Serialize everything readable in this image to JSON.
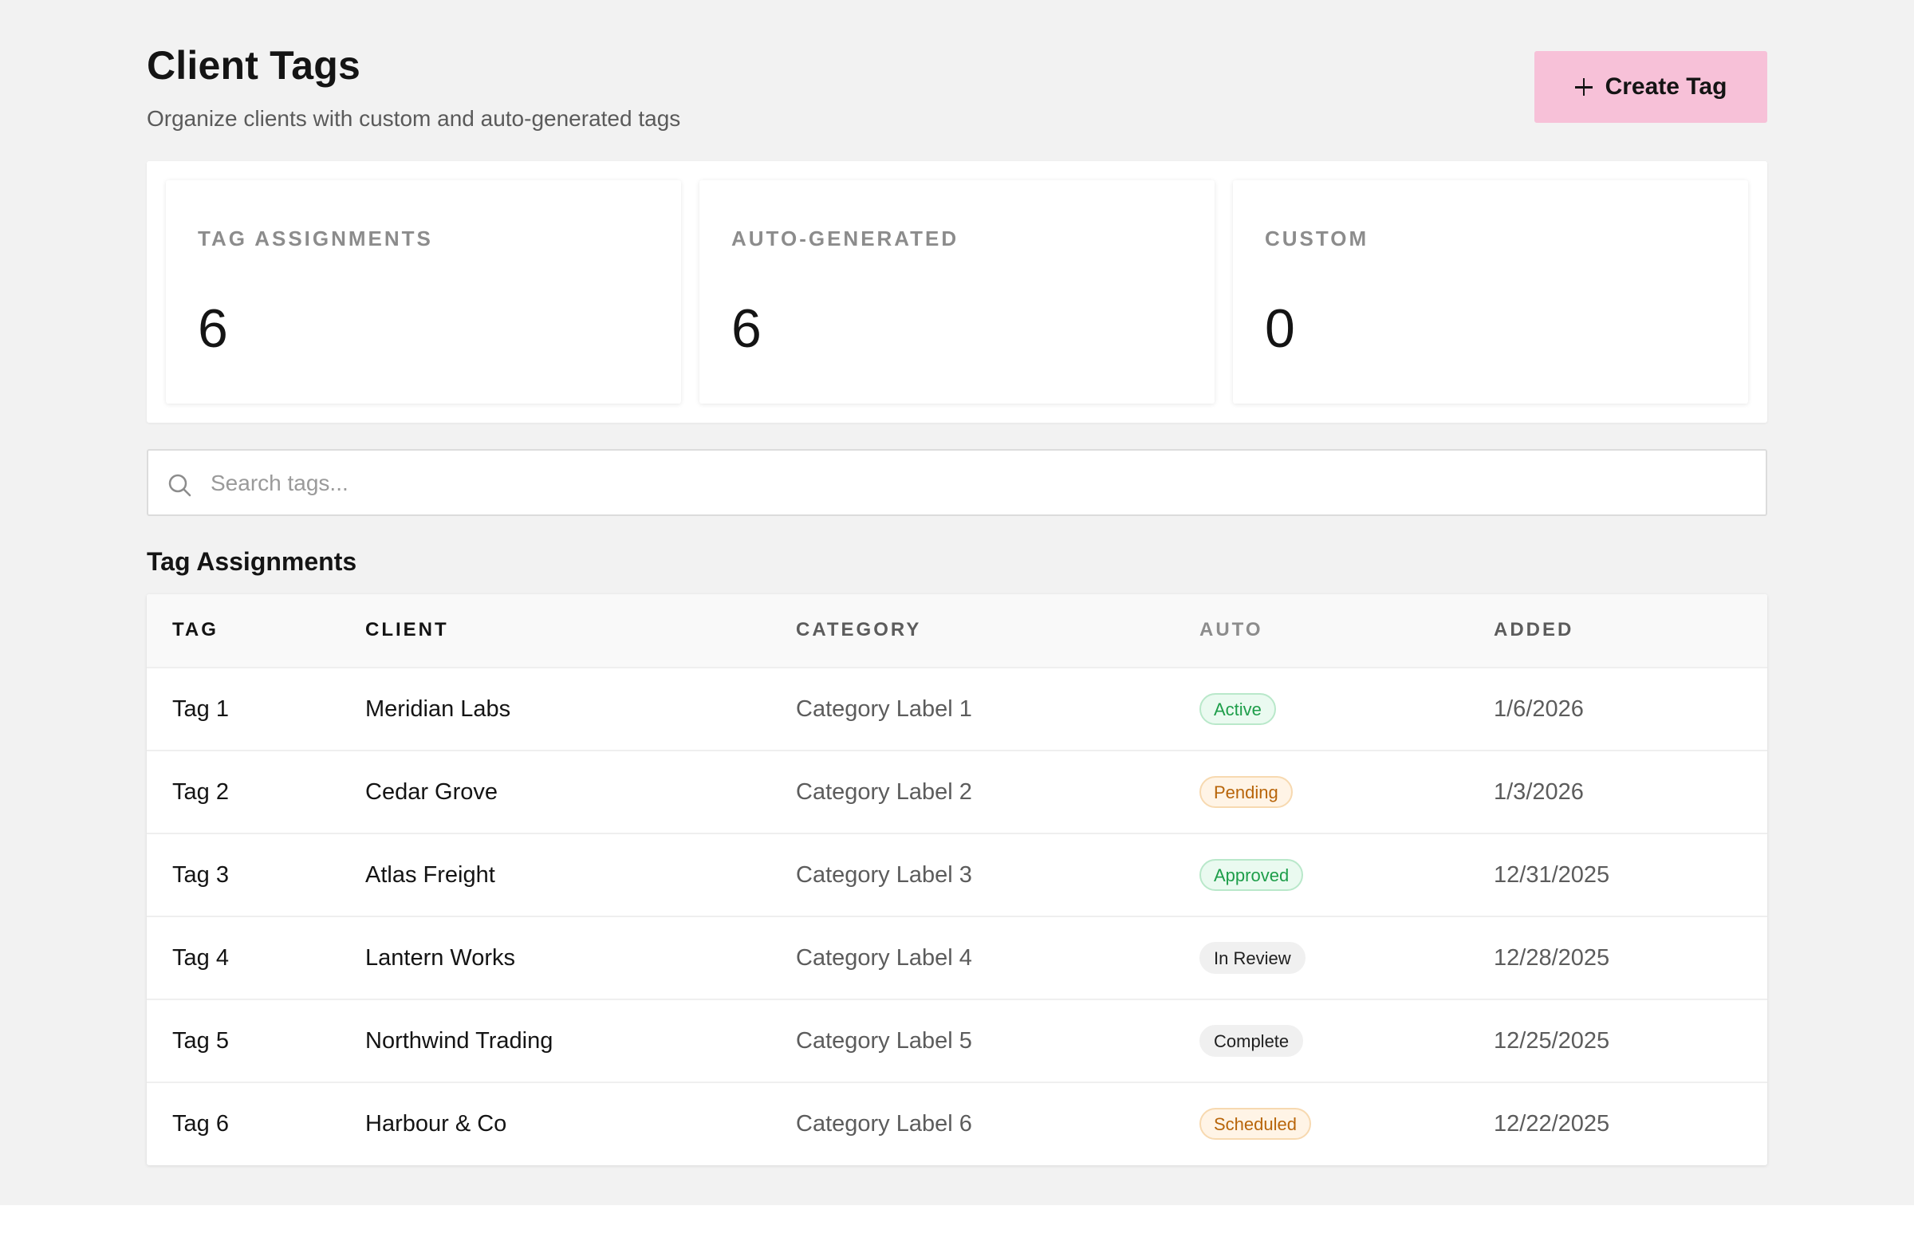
{
  "header": {
    "title": "Client Tags",
    "subtitle": "Organize clients with custom and auto-generated tags",
    "create_button_label": "Create Tag",
    "create_button_icon": "plus-icon"
  },
  "stats": [
    {
      "label": "TAG ASSIGNMENTS",
      "value": "6"
    },
    {
      "label": "AUTO-GENERATED",
      "value": "6"
    },
    {
      "label": "CUSTOM",
      "value": "0"
    }
  ],
  "search": {
    "placeholder": "Search tags...",
    "value": "",
    "icon": "search-icon"
  },
  "table": {
    "title": "Tag Assignments",
    "columns": [
      "TAG",
      "CLIENT",
      "CATEGORY",
      "AUTO",
      "ADDED"
    ],
    "rows": [
      {
        "tag": "Tag 1",
        "client": "Meridian Labs",
        "category": "Category Label 1",
        "auto": "Active",
        "added": "1/6/2026"
      },
      {
        "tag": "Tag 2",
        "client": "Cedar Grove",
        "category": "Category Label 2",
        "auto": "Pending",
        "added": "1/3/2026"
      },
      {
        "tag": "Tag 3",
        "client": "Atlas Freight",
        "category": "Category Label 3",
        "auto": "Approved",
        "added": "12/31/2025"
      },
      {
        "tag": "Tag 4",
        "client": "Lantern Works",
        "category": "Category Label 4",
        "auto": "In Review",
        "added": "12/28/2025"
      },
      {
        "tag": "Tag 5",
        "client": "Northwind Trading",
        "category": "Category Label 5",
        "auto": "Complete",
        "added": "12/25/2025"
      },
      {
        "tag": "Tag 6",
        "client": "Harbour & Co",
        "category": "Category Label 6",
        "auto": "Scheduled",
        "added": "12/22/2025"
      }
    ]
  },
  "colors": {
    "page_background": "#f2f2f2",
    "accent_button": "#f7c1d8",
    "badge_success_text": "#1e9e4a",
    "badge_warning_text": "#b8650a",
    "badge_neutral_text": "#1f1f1f"
  }
}
